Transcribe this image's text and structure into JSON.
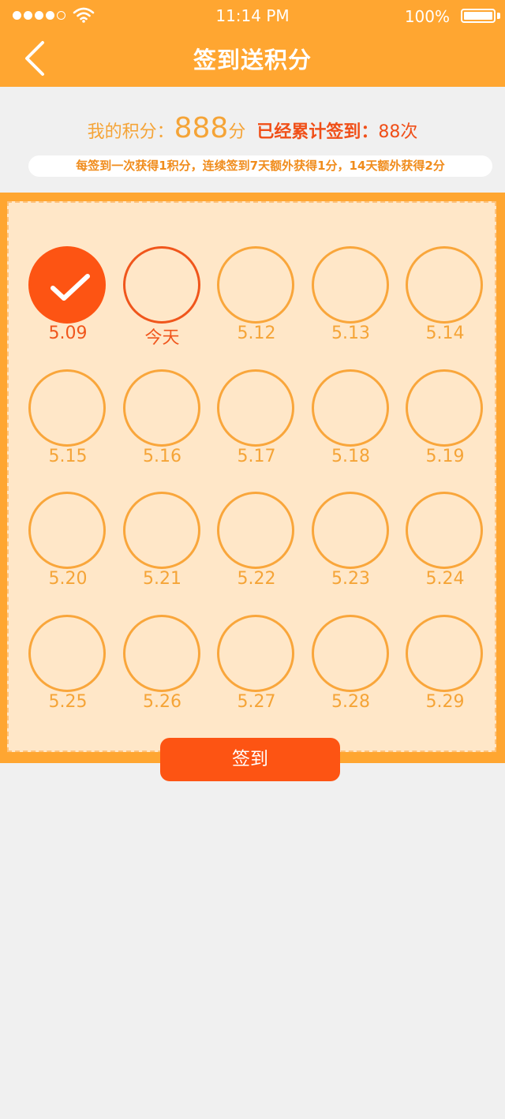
{
  "status_bar": {
    "time": "11:14 PM",
    "battery": "100%"
  },
  "nav": {
    "title": "签到送积分"
  },
  "stats": {
    "points_label": "我的积分：",
    "points_value": "888",
    "points_unit": "分",
    "checkin_label": "已经累计签到：",
    "checkin_value": "88",
    "checkin_unit": "次"
  },
  "rules": "每签到一次获得1积分，连续签到7天额外获得1分，14天额外获得2分",
  "days": [
    {
      "label": "5.09",
      "state": "checked"
    },
    {
      "label": "今天",
      "state": "today"
    },
    {
      "label": "5.12",
      "state": "future"
    },
    {
      "label": "5.13",
      "state": "future"
    },
    {
      "label": "5.14",
      "state": "future"
    },
    {
      "label": "5.15",
      "state": "future"
    },
    {
      "label": "5.16",
      "state": "future"
    },
    {
      "label": "5.17",
      "state": "future"
    },
    {
      "label": "5.18",
      "state": "future"
    },
    {
      "label": "5.19",
      "state": "future"
    },
    {
      "label": "5.20",
      "state": "future"
    },
    {
      "label": "5.21",
      "state": "future"
    },
    {
      "label": "5.22",
      "state": "future"
    },
    {
      "label": "5.23",
      "state": "future"
    },
    {
      "label": "5.24",
      "state": "future"
    },
    {
      "label": "5.25",
      "state": "future"
    },
    {
      "label": "5.26",
      "state": "future"
    },
    {
      "label": "5.27",
      "state": "future"
    },
    {
      "label": "5.28",
      "state": "future"
    },
    {
      "label": "5.29",
      "state": "future"
    }
  ],
  "sign_button": {
    "label": "签到"
  },
  "colors": {
    "primary": "#ffa631",
    "accent": "#fd5413",
    "panel": "#ffe7c8",
    "text_orange": "#f5a437"
  },
  "icons": {
    "back": "chevron-left-icon",
    "check": "checkmark-icon",
    "wifi": "wifi-icon",
    "battery": "battery-icon"
  }
}
